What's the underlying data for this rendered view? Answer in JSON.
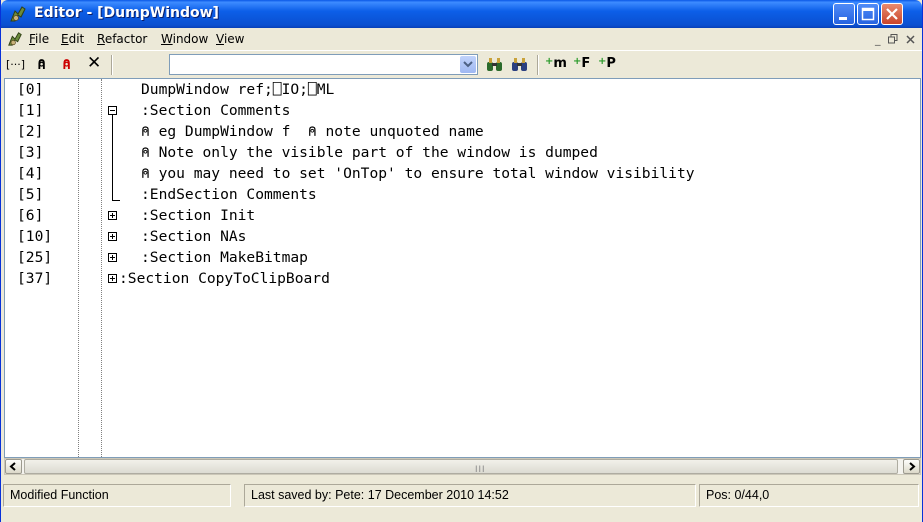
{
  "window": {
    "title": "Editor - [DumpWindow]"
  },
  "menu": {
    "items": [
      {
        "label": "File",
        "u": "F",
        "rest": "ile"
      },
      {
        "label": "Edit",
        "u": "E",
        "rest": "dit"
      },
      {
        "label": "Refactor",
        "u": "R",
        "rest": "efactor"
      },
      {
        "label": "Window",
        "u": "W",
        "rest": "indow"
      },
      {
        "label": "View",
        "u": "V",
        "rest": "iew"
      }
    ]
  },
  "toolbar": {
    "bracket_label": "[···]",
    "comment_label": "⍝",
    "uncomment_label": "⍝",
    "delete_label": "✕",
    "combo_value": "",
    "add_method_label": "m",
    "add_function_label": "F",
    "add_property_label": "P"
  },
  "code": {
    "lines": [
      {
        "num": "[0]",
        "text": "DumpWindow ref;⎕IO;⎕ML"
      },
      {
        "num": "[1]",
        "text": ":Section Comments"
      },
      {
        "num": "[2]",
        "text": "⍝ eg DumpWindow f  ⍝ note unquoted name"
      },
      {
        "num": "[3]",
        "text": "⍝ Note only the visible part of the window is dumped"
      },
      {
        "num": "[4]",
        "text": "⍝ you may need to set 'OnTop' to ensure total window visibility"
      },
      {
        "num": "[5]",
        "text": ":EndSection Comments"
      },
      {
        "num": "[6]",
        "text": ":Section Init"
      },
      {
        "num": "[10]",
        "text": ":Section NAs"
      },
      {
        "num": "[25]",
        "text": ":Section MakeBitmap"
      },
      {
        "num": "[37]",
        "text": ":Section CopyToClipBoard"
      }
    ]
  },
  "scrollbar": {
    "grip": "III"
  },
  "status": {
    "state": "Modified Function",
    "saved": "Last saved by: Pete: 17 December 2010 14:52",
    "pos": "Pos: 0/44,0"
  },
  "colors": {
    "titlebar": "#0a4fd0",
    "chrome": "#ece9d8",
    "close": "#c9442a"
  }
}
